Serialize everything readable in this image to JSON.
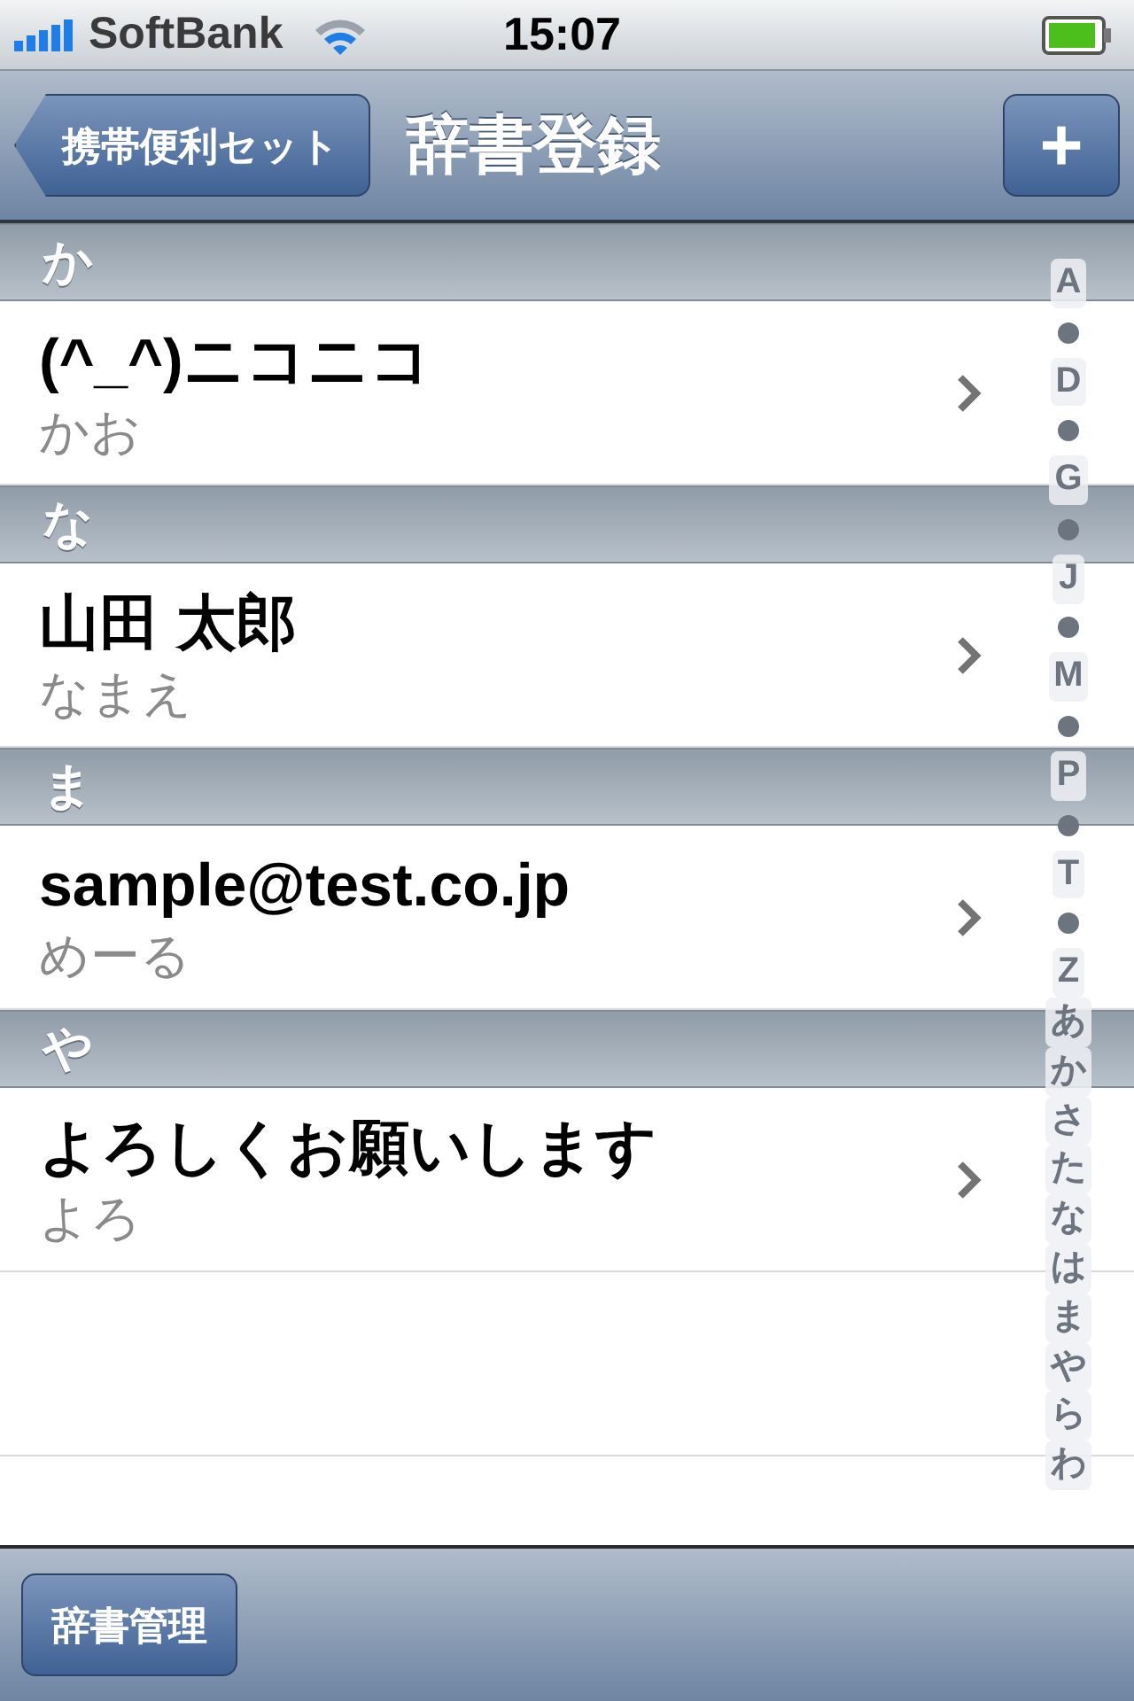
{
  "status_bar": {
    "carrier": "SoftBank",
    "time": "15:07"
  },
  "nav_bar": {
    "back_button": "携帯便利セット",
    "title": "辞書登録",
    "add_button": "+"
  },
  "sections": [
    {
      "header": "か",
      "rows": [
        {
          "title": "(^_^)ニコニコ",
          "subtitle": "かお"
        }
      ]
    },
    {
      "header": "な",
      "rows": [
        {
          "title": "山田 太郎",
          "subtitle": "なまえ"
        }
      ]
    },
    {
      "header": "ま",
      "rows": [
        {
          "title": "sample@test.co.jp",
          "subtitle": "めーる"
        }
      ]
    },
    {
      "header": "や",
      "rows": [
        {
          "title": "よろしくお願いします",
          "subtitle": "よろ"
        }
      ]
    }
  ],
  "index": [
    {
      "kind": "letter",
      "label": "A"
    },
    {
      "kind": "dot"
    },
    {
      "kind": "letter",
      "label": "D"
    },
    {
      "kind": "dot"
    },
    {
      "kind": "letter",
      "label": "G"
    },
    {
      "kind": "dot"
    },
    {
      "kind": "letter",
      "label": "J"
    },
    {
      "kind": "dot"
    },
    {
      "kind": "letter",
      "label": "M"
    },
    {
      "kind": "dot"
    },
    {
      "kind": "letter",
      "label": "P"
    },
    {
      "kind": "dot"
    },
    {
      "kind": "letter",
      "label": "T"
    },
    {
      "kind": "dot"
    },
    {
      "kind": "letter",
      "label": "Z"
    },
    {
      "kind": "letter",
      "label": "あ"
    },
    {
      "kind": "letter",
      "label": "か"
    },
    {
      "kind": "letter",
      "label": "さ"
    },
    {
      "kind": "letter",
      "label": "た"
    },
    {
      "kind": "letter",
      "label": "な"
    },
    {
      "kind": "letter",
      "label": "は"
    },
    {
      "kind": "letter",
      "label": "ま"
    },
    {
      "kind": "letter",
      "label": "や"
    },
    {
      "kind": "letter",
      "label": "ら"
    },
    {
      "kind": "letter",
      "label": "わ"
    }
  ],
  "toolbar": {
    "button": "辞書管理"
  }
}
